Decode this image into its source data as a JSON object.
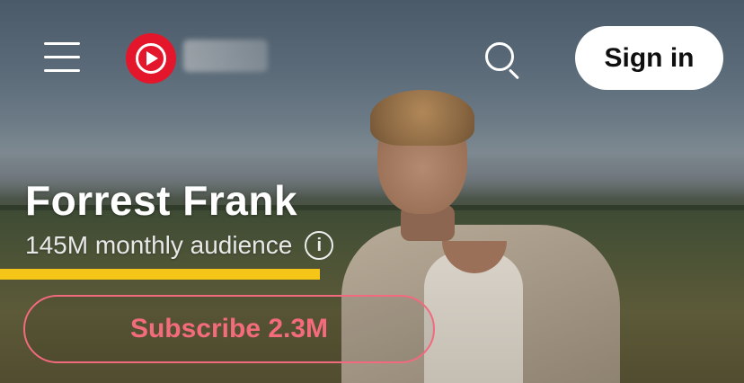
{
  "header": {
    "menu_icon": "hamburger-menu-icon",
    "logo_icon": "youtube-music-logo-icon",
    "search_icon": "search-icon",
    "sign_in_label": "Sign in"
  },
  "artist": {
    "name": "Forrest Frank",
    "audience": "145M monthly audience",
    "info_icon": "info-icon",
    "info_glyph": "i"
  },
  "progress": {
    "fraction": 0.43,
    "color": "#f5c518"
  },
  "subscribe": {
    "label": "Subscribe 2.3M",
    "color": "#f36b7d"
  },
  "colors": {
    "logo_red": "#e3162b",
    "accent": "#f36b7d"
  }
}
